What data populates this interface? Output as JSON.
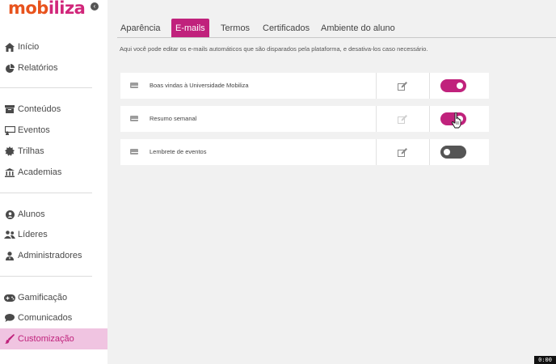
{
  "brand": {
    "logo_part1": "mob",
    "logo_part2": "iliza"
  },
  "sidebar": {
    "items": [
      {
        "label": "Início",
        "icon": "home-icon"
      },
      {
        "label": "Relatórios",
        "icon": "pie-chart-icon"
      },
      {
        "label": "Conteúdos",
        "icon": "archive-icon"
      },
      {
        "label": "Eventos",
        "icon": "presentation-icon"
      },
      {
        "label": "Trilhas",
        "icon": "gear-badge-icon"
      },
      {
        "label": "Academias",
        "icon": "institution-icon"
      },
      {
        "label": "Alunos",
        "icon": "user-circle-icon"
      },
      {
        "label": "Líderes",
        "icon": "users-icon"
      },
      {
        "label": "Administradores",
        "icon": "user-tie-icon"
      },
      {
        "label": "Gamificação",
        "icon": "gamepad-icon"
      },
      {
        "label": "Comunicados",
        "icon": "chat-bubble-icon"
      },
      {
        "label": "Customização",
        "icon": "paint-brush-icon",
        "active": true
      }
    ]
  },
  "tabs": [
    {
      "label": "Aparência"
    },
    {
      "label": "E-mails",
      "active": true
    },
    {
      "label": "Termos"
    },
    {
      "label": "Certificados"
    },
    {
      "label": "Ambiente do aluno"
    }
  ],
  "description": "Aqui você pode editar os e-mails automáticos que são disparados pela plataforma, e desativa-los caso necessário.",
  "emails": [
    {
      "name": "Boas vindas à Universidade Mobiliza",
      "enabled": true
    },
    {
      "name": "Resumo semanal",
      "enabled": true
    },
    {
      "name": "Lembrete de eventos",
      "enabled": false
    }
  ],
  "timer": "0:00",
  "colors": {
    "accent": "#c0227c",
    "logo_orange": "#e8531d",
    "active_bg": "#f0c4e1"
  }
}
